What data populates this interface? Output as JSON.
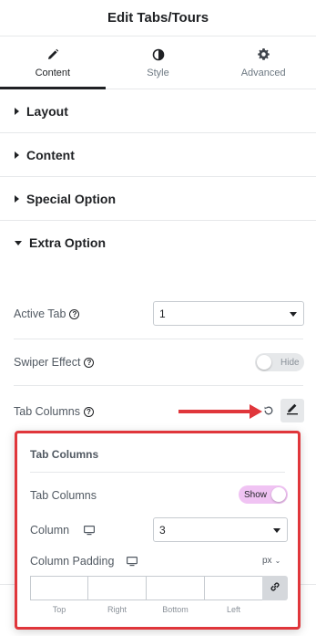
{
  "header": {
    "title": "Edit Tabs/Tours"
  },
  "tabs": [
    {
      "label": "Content",
      "icon": "pencil-icon",
      "active": true
    },
    {
      "label": "Style",
      "icon": "half-circle-icon",
      "active": false
    },
    {
      "label": "Advanced",
      "icon": "gear-icon",
      "active": false
    }
  ],
  "sections": [
    {
      "label": "Layout",
      "open": false
    },
    {
      "label": "Content",
      "open": false
    },
    {
      "label": "Special Option",
      "open": false
    },
    {
      "label": "Extra Option",
      "open": true
    }
  ],
  "extra_option": {
    "active_tab": {
      "label": "Active Tab",
      "value": "1"
    },
    "swiper_effect": {
      "label": "Swiper Effect",
      "toggle_text": "Hide",
      "enabled": false
    },
    "tab_columns": {
      "label": "Tab Columns"
    }
  },
  "popup": {
    "title": "Tab Columns",
    "tab_columns_toggle": {
      "label": "Tab Columns",
      "toggle_text": "Show",
      "enabled": true
    },
    "column": {
      "label": "Column",
      "value": "3"
    },
    "column_padding": {
      "label": "Column Padding",
      "unit": "px",
      "fields": [
        "Top",
        "Right",
        "Bottom",
        "Left"
      ],
      "values": [
        "",
        "",
        "",
        ""
      ]
    }
  },
  "colors": {
    "accent_pink": "#f0c3f3",
    "annotation_red": "#e0363b",
    "text_dark": "#1f2124"
  }
}
